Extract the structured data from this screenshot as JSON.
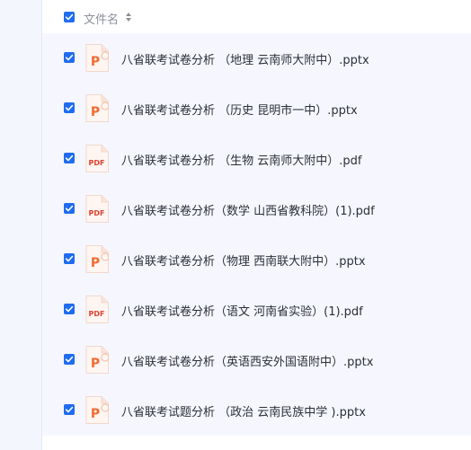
{
  "header": {
    "column_title": "文件名",
    "select_all_checked": true
  },
  "icons": {
    "pptx": {
      "badge": "P",
      "color": "#f46b2f"
    },
    "pdf": {
      "badge": "PDF",
      "color": "#e0422f"
    }
  },
  "files": [
    {
      "name": "八省联考试卷分析 （地理 云南师大附中）.pptx",
      "type": "pptx",
      "checked": true
    },
    {
      "name": "八省联考试卷分析 （历史 昆明市一中）.pptx",
      "type": "pptx",
      "checked": true
    },
    {
      "name": "八省联考试卷分析 （生物 云南师大附中）.pdf",
      "type": "pdf",
      "checked": true
    },
    {
      "name": "八省联考试卷分析（数学 山西省教科院）(1).pdf",
      "type": "pdf",
      "checked": true
    },
    {
      "name": "八省联考试卷分析（物理 西南联大附中）.pptx",
      "type": "pptx",
      "checked": true
    },
    {
      "name": "八省联考试卷分析（语文 河南省实验）(1).pdf",
      "type": "pdf",
      "checked": true
    },
    {
      "name": "八省联考试卷分析（英语西安外国语附中）.pptx",
      "type": "pptx",
      "checked": true
    },
    {
      "name": "八省联考试题分析 （政治 云南民族中学 ).pptx",
      "type": "pptx",
      "checked": true
    }
  ]
}
